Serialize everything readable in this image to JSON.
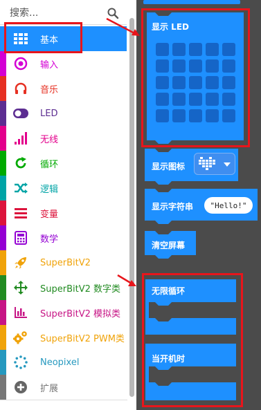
{
  "search": {
    "placeholder": "搜索..."
  },
  "categories": [
    {
      "label": "基本",
      "color": "#1e90ff",
      "icon": "grid-icon",
      "selected": true
    },
    {
      "label": "输入",
      "color": "#d400d4",
      "icon": "radio-target-icon"
    },
    {
      "label": "音乐",
      "color": "#e63022",
      "icon": "headphones-icon"
    },
    {
      "label": "LED",
      "color": "#5c2d91",
      "icon": "toggle-icon"
    },
    {
      "label": "无线",
      "color": "#e3008c",
      "icon": "signal-bars-icon"
    },
    {
      "label": "循环",
      "color": "#00aa00",
      "icon": "refresh-icon"
    },
    {
      "label": "逻辑",
      "color": "#00a4a6",
      "icon": "shuffle-icon"
    },
    {
      "label": "变量",
      "color": "#dc143c",
      "icon": "lines-icon"
    },
    {
      "label": "数学",
      "color": "#9400d3",
      "icon": "calculator-icon"
    },
    {
      "label": "SuperBitV2",
      "color": "#f0a30a",
      "icon": "rocket-icon"
    },
    {
      "label": "SuperBitV2 数字类",
      "color": "#228b22",
      "icon": "move-arrows-icon"
    },
    {
      "label": "SuperBitV2 模拟类",
      "color": "#c71585",
      "icon": "bar-chart-icon"
    },
    {
      "label": "SuperBitV2 PWM类",
      "color": "#f0a30a",
      "icon": "gears-icon"
    },
    {
      "label": "Neopixel",
      "color": "#2699bf",
      "icon": "dotted-circle-icon"
    },
    {
      "label": "扩展",
      "color": "#777777",
      "icon": "plus-circle-icon"
    }
  ],
  "blocks": {
    "show_leds": "显示 LED",
    "show_icon": "显示图标",
    "show_string": "显示字符串",
    "string_value": "\"Hello!\"",
    "clear_screen": "清空屏幕",
    "forever": "无限循环",
    "on_start": "当开机时"
  },
  "colors": {
    "block_blue": "#1e90ff",
    "highlight_red": "#e8151b",
    "workspace_bg": "#4b4b4b"
  }
}
